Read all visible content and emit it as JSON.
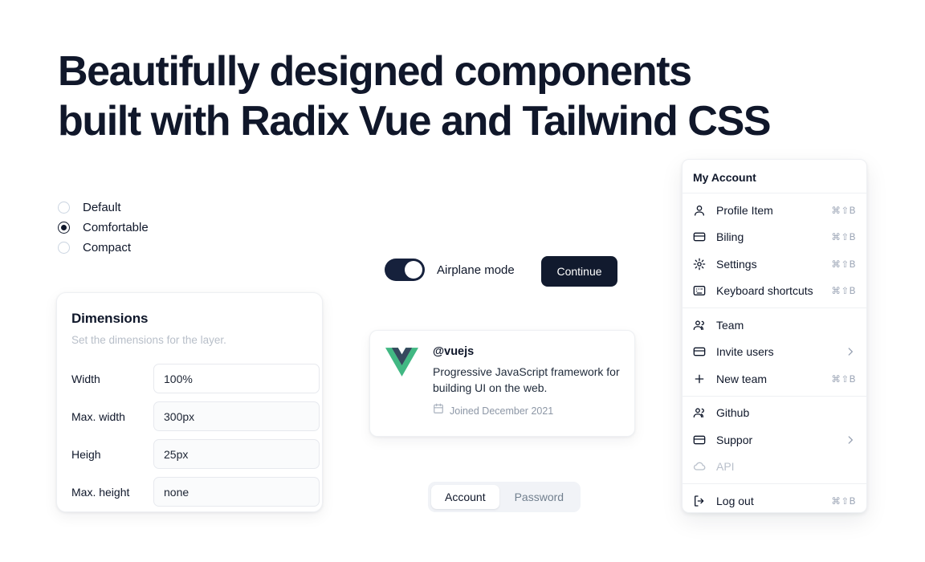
{
  "hero": {
    "line1": "Beautifully designed components",
    "line2": "built with Radix Vue and Tailwind CSS"
  },
  "radio_group": {
    "options": [
      {
        "label": "Default",
        "checked": false
      },
      {
        "label": "Comfortable",
        "checked": true
      },
      {
        "label": "Compact",
        "checked": false
      }
    ]
  },
  "dimensions_card": {
    "title": "Dimensions",
    "subtitle": "Set the dimensions for the layer.",
    "fields": [
      {
        "label": "Width",
        "value": "100%"
      },
      {
        "label": "Max. width",
        "value": "300px"
      },
      {
        "label": "Heigh",
        "value": "25px"
      },
      {
        "label": "Max. height",
        "value": "none"
      }
    ]
  },
  "switch": {
    "label": "Airplane mode",
    "checked": true
  },
  "continue_button": {
    "label": "Continue"
  },
  "hover_card": {
    "icon": "vue-logo-icon",
    "handle": "@vuejs",
    "description": "Progressive JavaScript framework for building UI on the web.",
    "joined_icon": "calendar-icon",
    "joined": "Joined December 2021"
  },
  "tabs": {
    "items": [
      {
        "label": "Account",
        "active": true
      },
      {
        "label": "Password",
        "active": false
      }
    ]
  },
  "menu": {
    "header": "My Account",
    "groups": [
      {
        "items": [
          {
            "icon": "user-icon",
            "label": "Profile Item",
            "shortcut": "⌘⇧B",
            "chevron": false,
            "disabled": false
          },
          {
            "icon": "credit-card-icon",
            "label": "Biling",
            "shortcut": "⌘⇧B",
            "chevron": false,
            "disabled": false
          },
          {
            "icon": "gear-icon",
            "label": "Settings",
            "shortcut": "⌘⇧B",
            "chevron": false,
            "disabled": false
          },
          {
            "icon": "keyboard-icon",
            "label": "Keyboard shortcuts",
            "shortcut": "⌘⇧B",
            "chevron": false,
            "disabled": false
          }
        ]
      },
      {
        "items": [
          {
            "icon": "users-icon",
            "label": "Team",
            "shortcut": "",
            "chevron": false,
            "disabled": false
          },
          {
            "icon": "credit-card-icon",
            "label": "Invite users",
            "shortcut": "",
            "chevron": true,
            "disabled": false
          },
          {
            "icon": "plus-icon",
            "label": "New team",
            "shortcut": "⌘⇧B",
            "chevron": false,
            "disabled": false
          }
        ]
      },
      {
        "items": [
          {
            "icon": "users-icon",
            "label": "Github",
            "shortcut": "",
            "chevron": false,
            "disabled": false
          },
          {
            "icon": "credit-card-icon",
            "label": "Suppor",
            "shortcut": "",
            "chevron": true,
            "disabled": false
          },
          {
            "icon": "cloud-icon",
            "label": "API",
            "shortcut": "",
            "chevron": false,
            "disabled": true
          }
        ]
      },
      {
        "items": [
          {
            "icon": "logout-icon",
            "label": "Log out",
            "shortcut": "⌘⇧B",
            "chevron": false,
            "disabled": false
          }
        ]
      }
    ]
  },
  "colors": {
    "text": "#0f172a",
    "muted": "#98a2b3",
    "border": "#eef0f3",
    "accent_dark": "#111a2e",
    "vue_green": "#41b883",
    "vue_navy": "#35495e"
  }
}
